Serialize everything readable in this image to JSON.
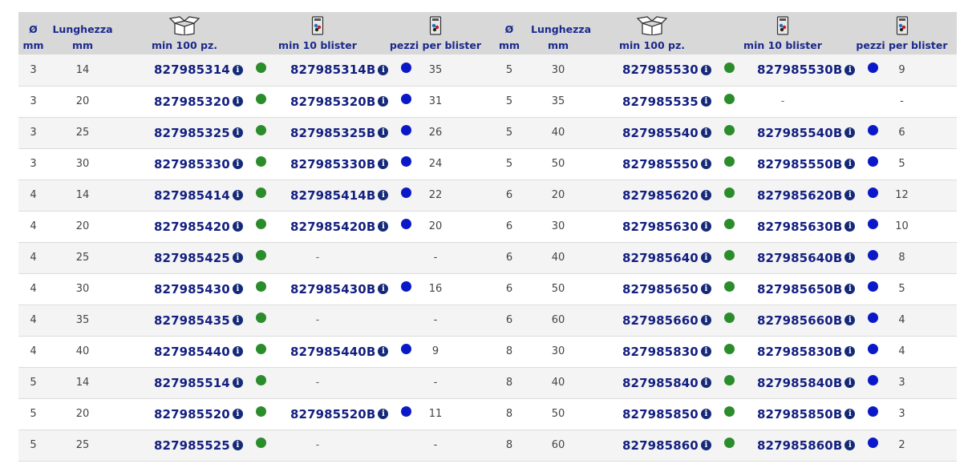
{
  "colors": {
    "header_bg": "#d8d8d8",
    "header_text": "#1a2a8c",
    "code_text": "#142080",
    "info_icon": "#142a78",
    "available_dot": "#2b8c2b",
    "blister_dot": "#0a18c8"
  },
  "headers": {
    "diam_symbol": "Ø",
    "diam_unit": "mm",
    "length_label": "Lunghezza",
    "length_unit": "mm",
    "min100": "min 100 pz.",
    "min10blister": "min 10 blister",
    "pieces_per_blister": "pezzi per blister"
  },
  "icons": {
    "box": "box-icon",
    "blister": "blister-icon",
    "info": "info-icon",
    "green_dot": "green-dot-icon",
    "blue_dot": "blue-dot-icon"
  },
  "info_glyph": "i",
  "rows": [
    {
      "l": {
        "d": "3",
        "len": "14",
        "code": "827985314",
        "bcode": "827985314B",
        "pcs": "35"
      },
      "r": {
        "d": "5",
        "len": "30",
        "code": "827985530",
        "bcode": "827985530B",
        "pcs": "9"
      }
    },
    {
      "l": {
        "d": "3",
        "len": "20",
        "code": "827985320",
        "bcode": "827985320B",
        "pcs": "31"
      },
      "r": {
        "d": "5",
        "len": "35",
        "code": "827985535",
        "bcode": "-",
        "pcs": "-"
      }
    },
    {
      "l": {
        "d": "3",
        "len": "25",
        "code": "827985325",
        "bcode": "827985325B",
        "pcs": "26"
      },
      "r": {
        "d": "5",
        "len": "40",
        "code": "827985540",
        "bcode": "827985540B",
        "pcs": "6"
      }
    },
    {
      "l": {
        "d": "3",
        "len": "30",
        "code": "827985330",
        "bcode": "827985330B",
        "pcs": "24"
      },
      "r": {
        "d": "5",
        "len": "50",
        "code": "827985550",
        "bcode": "827985550B",
        "pcs": "5"
      }
    },
    {
      "l": {
        "d": "4",
        "len": "14",
        "code": "827985414",
        "bcode": "827985414B",
        "pcs": "22"
      },
      "r": {
        "d": "6",
        "len": "20",
        "code": "827985620",
        "bcode": "827985620B",
        "pcs": "12"
      }
    },
    {
      "l": {
        "d": "4",
        "len": "20",
        "code": "827985420",
        "bcode": "827985420B",
        "pcs": "20"
      },
      "r": {
        "d": "6",
        "len": "30",
        "code": "827985630",
        "bcode": "827985630B",
        "pcs": "10"
      }
    },
    {
      "l": {
        "d": "4",
        "len": "25",
        "code": "827985425",
        "bcode": "-",
        "pcs": "-"
      },
      "r": {
        "d": "6",
        "len": "40",
        "code": "827985640",
        "bcode": "827985640B",
        "pcs": "8"
      }
    },
    {
      "l": {
        "d": "4",
        "len": "30",
        "code": "827985430",
        "bcode": "827985430B",
        "pcs": "16"
      },
      "r": {
        "d": "6",
        "len": "50",
        "code": "827985650",
        "bcode": "827985650B",
        "pcs": "5"
      }
    },
    {
      "l": {
        "d": "4",
        "len": "35",
        "code": "827985435",
        "bcode": "-",
        "pcs": "-"
      },
      "r": {
        "d": "6",
        "len": "60",
        "code": "827985660",
        "bcode": "827985660B",
        "pcs": "4"
      }
    },
    {
      "l": {
        "d": "4",
        "len": "40",
        "code": "827985440",
        "bcode": "827985440B",
        "pcs": "9"
      },
      "r": {
        "d": "8",
        "len": "30",
        "code": "827985830",
        "bcode": "827985830B",
        "pcs": "4"
      }
    },
    {
      "l": {
        "d": "5",
        "len": "14",
        "code": "827985514",
        "bcode": "-",
        "pcs": "-"
      },
      "r": {
        "d": "8",
        "len": "40",
        "code": "827985840",
        "bcode": "827985840B",
        "pcs": "3"
      }
    },
    {
      "l": {
        "d": "5",
        "len": "20",
        "code": "827985520",
        "bcode": "827985520B",
        "pcs": "11"
      },
      "r": {
        "d": "8",
        "len": "50",
        "code": "827985850",
        "bcode": "827985850B",
        "pcs": "3"
      }
    },
    {
      "l": {
        "d": "5",
        "len": "25",
        "code": "827985525",
        "bcode": "-",
        "pcs": "-"
      },
      "r": {
        "d": "8",
        "len": "60",
        "code": "827985860",
        "bcode": "827985860B",
        "pcs": "2"
      }
    }
  ]
}
